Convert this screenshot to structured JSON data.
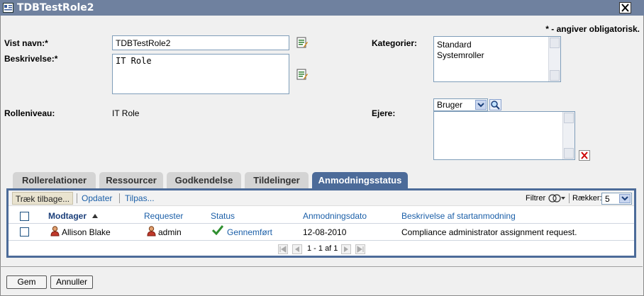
{
  "window": {
    "title": "TDBTestRole2"
  },
  "form": {
    "required_note": "* - angiver obligatorisk.",
    "display_name_label": "Vist navn:*",
    "display_name_value": "TDBTestRole2",
    "description_label": "Beskrivelse:*",
    "description_value": "IT Role",
    "role_level_label": "Rolleniveau:",
    "role_level_value": "IT Role",
    "categories_label": "Kategorier:",
    "categories": [
      "Standard",
      "Systemroller"
    ],
    "owners_label": "Ejere:",
    "owners_type": "Bruger"
  },
  "tabs": [
    {
      "label": "Rollerelationer",
      "active": false
    },
    {
      "label": "Ressourcer",
      "active": false
    },
    {
      "label": "Godkendelse",
      "active": false
    },
    {
      "label": "Tildelinger",
      "active": false
    },
    {
      "label": "Anmodningsstatus",
      "active": true
    }
  ],
  "toolbar": {
    "retract": "Træk tilbage...",
    "refresh": "Opdater",
    "customize": "Tilpas...",
    "filter": "Filtrer",
    "rows_label": "Rækker:",
    "rows_value": "5"
  },
  "table": {
    "headers": [
      "Modtager",
      "Requester",
      "Status",
      "Anmodningsdato",
      "Beskrivelse af startanmodning"
    ],
    "rows": [
      {
        "recipient": "Allison Blake",
        "requester": "admin",
        "status": "Gennemført",
        "date": "12-08-2010",
        "description": "Compliance administrator assignment request."
      }
    ],
    "pager_text": "1 - 1 af 1"
  },
  "footer": {
    "save": "Gem",
    "cancel": "Annuller"
  },
  "colors": {
    "title_bar": "#6f819f",
    "tab_active": "#4c6b99",
    "link": "#1b5fa8"
  }
}
